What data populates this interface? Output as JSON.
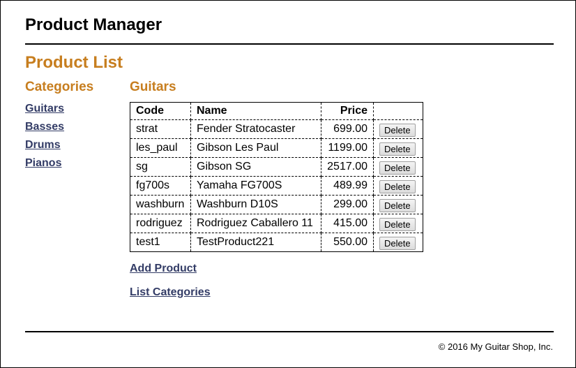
{
  "header": {
    "title": "Product Manager"
  },
  "page_title": "Product List",
  "sidebar": {
    "heading": "Categories",
    "items": [
      {
        "label": "Guitars"
      },
      {
        "label": "Basses"
      },
      {
        "label": "Drums"
      },
      {
        "label": "Pianos"
      }
    ]
  },
  "main": {
    "category_heading": "Guitars",
    "columns": {
      "code": "Code",
      "name": "Name",
      "price": "Price"
    },
    "delete_label": "Delete",
    "rows": [
      {
        "code": "strat",
        "name": "Fender Stratocaster",
        "price": "699.00"
      },
      {
        "code": "les_paul",
        "name": "Gibson Les Paul",
        "price": "1199.00"
      },
      {
        "code": "sg",
        "name": "Gibson SG",
        "price": "2517.00"
      },
      {
        "code": "fg700s",
        "name": "Yamaha FG700S",
        "price": "489.99"
      },
      {
        "code": "washburn",
        "name": "Washburn D10S",
        "price": "299.00"
      },
      {
        "code": "rodriguez",
        "name": "Rodriguez Caballero 11",
        "price": "415.00"
      },
      {
        "code": "test1",
        "name": "TestProduct221",
        "price": "550.00"
      }
    ],
    "add_product_label": "Add Product",
    "list_categories_label": "List Categories"
  },
  "footer": {
    "text": "© 2016 My Guitar Shop, Inc."
  },
  "colors": {
    "accent": "#c77e1f",
    "link": "#333c66"
  }
}
